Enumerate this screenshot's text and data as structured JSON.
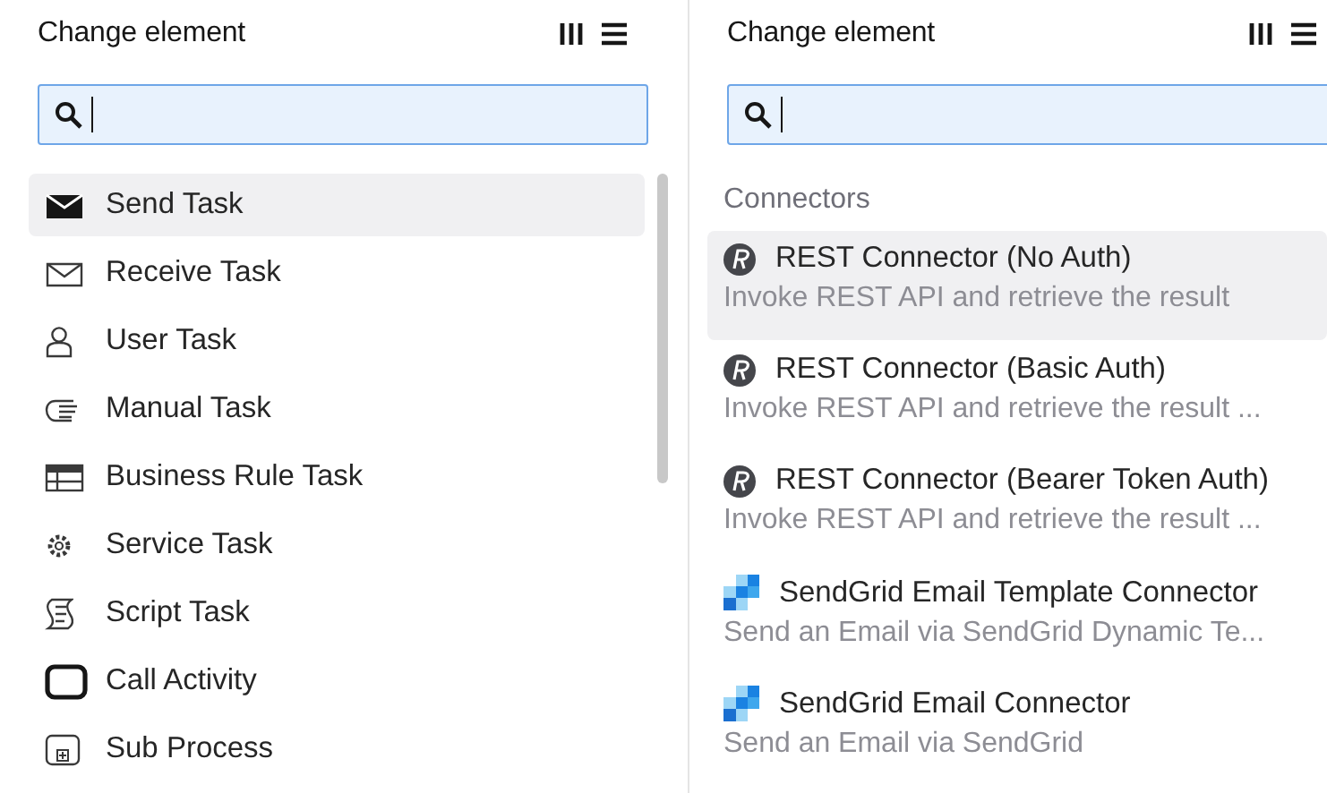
{
  "panels": [
    {
      "title": "Change element",
      "items": [
        {
          "label": "Send Task",
          "kind": "send",
          "selected": true
        },
        {
          "label": "Receive Task",
          "kind": "receive",
          "selected": false
        },
        {
          "label": "User Task",
          "kind": "user",
          "selected": false
        },
        {
          "label": "Manual Task",
          "kind": "manual",
          "selected": false
        },
        {
          "label": "Business Rule Task",
          "kind": "rule",
          "selected": false
        },
        {
          "label": "Service Task",
          "kind": "service",
          "selected": false
        },
        {
          "label": "Script Task",
          "kind": "script",
          "selected": false
        },
        {
          "label": "Call Activity",
          "kind": "call",
          "selected": false
        },
        {
          "label": "Sub Process",
          "kind": "subprocess",
          "selected": false
        }
      ]
    },
    {
      "title": "Change element",
      "section": "Connectors",
      "items": [
        {
          "label": "REST Connector (No Auth)",
          "description": "Invoke REST API and retrieve the result",
          "kind": "rest",
          "selected": true
        },
        {
          "label": "REST Connector (Basic Auth)",
          "description": "Invoke REST API and retrieve the result ...",
          "kind": "rest",
          "selected": false
        },
        {
          "label": "REST Connector (Bearer Token Auth)",
          "description": "Invoke REST API and retrieve the result ...",
          "kind": "rest",
          "selected": false
        },
        {
          "label": "SendGrid Email Template Connector",
          "description": "Send an Email via SendGrid Dynamic Te...",
          "kind": "sendgrid",
          "selected": false
        },
        {
          "label": "SendGrid Email Connector",
          "description": "Send an Email via SendGrid",
          "kind": "sendgrid",
          "selected": false
        }
      ]
    }
  ]
}
